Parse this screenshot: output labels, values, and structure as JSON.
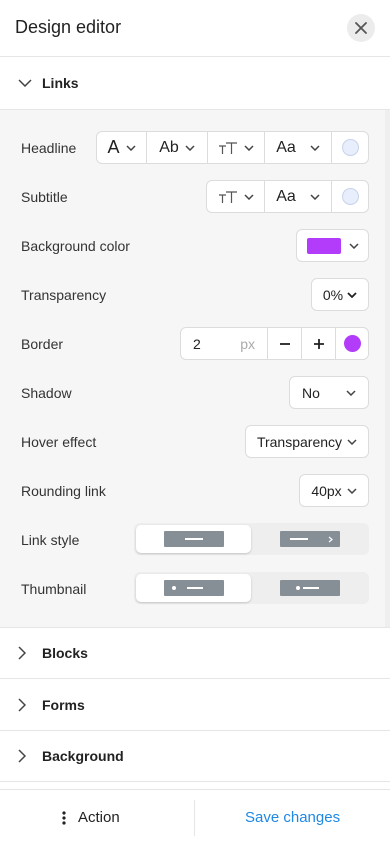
{
  "header": {
    "title": "Design editor",
    "close_icon": "close-icon"
  },
  "sections": {
    "links": "Links",
    "blocks": "Blocks",
    "forms": "Forms",
    "background": "Background"
  },
  "rows": {
    "headline": {
      "label": "Headline",
      "font": "A",
      "style": "Ab",
      "size_icon": "text-size-icon",
      "case": "Aa"
    },
    "subtitle": {
      "label": "Subtitle",
      "size_icon": "text-size-icon",
      "case": "Aa"
    },
    "background_color": {
      "label": "Background color",
      "color": "#b23cfa"
    },
    "transparency": {
      "label": "Transparency",
      "value": "0%"
    },
    "border": {
      "label": "Border",
      "value": "2",
      "unit": "px",
      "minus": "−",
      "plus": "+",
      "color": "#b23cfa"
    },
    "shadow": {
      "label": "Shadow",
      "value": "No"
    },
    "hover_effect": {
      "label": "Hover effect",
      "value": "Transparency"
    },
    "rounding": {
      "label": "Rounding link",
      "value": "40px"
    },
    "link_style": {
      "label": "Link style",
      "selected": 0
    },
    "thumbnail": {
      "label": "Thumbnail",
      "selected": 0
    }
  },
  "footer": {
    "action_label": "Action",
    "save_label": "Save changes"
  },
  "colors": {
    "accent": "#1e88e5",
    "swatch": "#b23cfa"
  }
}
